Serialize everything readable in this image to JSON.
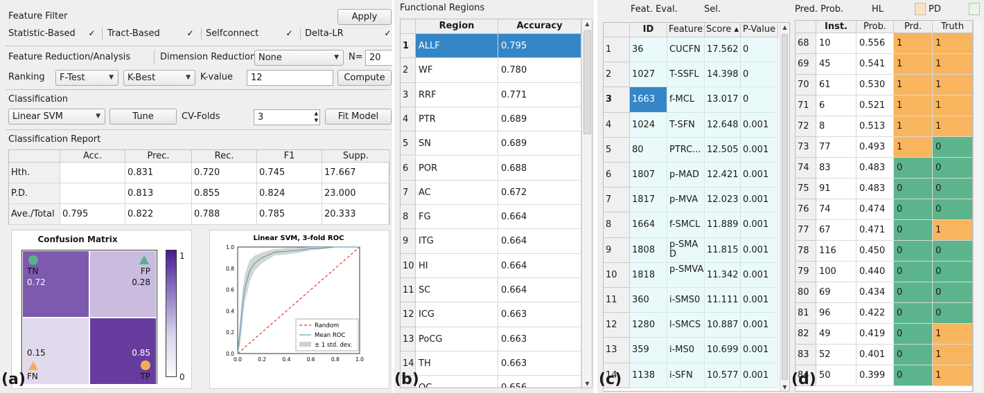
{
  "panel_a": {
    "feature_filter": {
      "title": "Feature Filter",
      "apply_label": "Apply",
      "checks": [
        {
          "label": "Statistic-Based",
          "mark": "✓"
        },
        {
          "label": "Tract-Based",
          "mark": "✓"
        },
        {
          "label": "Selfconnect",
          "mark": "✓"
        },
        {
          "label": "Delta-LR",
          "mark": "✓"
        }
      ]
    },
    "reduction": {
      "title": "Feature Reduction/Analysis",
      "dim_label": "Dimension Reduction",
      "dim_value": "None",
      "n_label": "N=",
      "n_value": "20",
      "ranking_label": "Ranking",
      "ranking_value": "F-Test",
      "kbest_value": "K-Best",
      "kvalue_label": "K-value",
      "kvalue_value": "12",
      "compute_label": "Compute"
    },
    "classification": {
      "title": "Classification",
      "model_value": "Linear SVM",
      "tune_label": "Tune",
      "cv_label": "CV-Folds",
      "cv_value": "3",
      "fit_label": "Fit Model"
    },
    "report": {
      "title": "Classification Report",
      "columns": [
        "",
        "Acc.",
        "Prec.",
        "Rec.",
        "F1",
        "Supp."
      ],
      "rows": [
        [
          "Hth.",
          "",
          "0.831",
          "0.720",
          "0.745",
          "17.667"
        ],
        [
          "P.D.",
          "",
          "0.813",
          "0.855",
          "0.824",
          "23.000"
        ],
        [
          "Ave./Total",
          "0.795",
          "0.822",
          "0.788",
          "0.785",
          "20.333"
        ]
      ]
    },
    "confusion": {
      "title": "Confusion Matrix",
      "cells": [
        {
          "tag": "TN",
          "value": "0.72",
          "level": 0.72,
          "marker": "circle"
        },
        {
          "tag": "FP",
          "value": "0.28",
          "level": 0.28,
          "marker": "triangle"
        },
        {
          "tag": "FN",
          "value": "0.15",
          "level": 0.15,
          "marker": "triangle"
        },
        {
          "tag": "TP",
          "value": "0.85",
          "level": 0.85,
          "marker": "circle"
        }
      ],
      "colorbar_max": "1",
      "colorbar_min": "0",
      "colors": {
        "marker_green": "#55b38a",
        "marker_orange": "#f5ad55",
        "cmap_high": "#4b1b8e",
        "cmap_low": "#fcfbfd"
      }
    },
    "roc": {
      "chart_data": {
        "type": "line",
        "title": "Linear SVM, 3-fold ROC",
        "xlim": [
          0,
          1
        ],
        "ylim": [
          0,
          1
        ],
        "x_ticks": [
          "0.0",
          "0.2",
          "0.4",
          "0.6",
          "0.8",
          "1.0"
        ],
        "y_ticks": [
          "0.0",
          "0.2",
          "0.4",
          "0.6",
          "0.8",
          "1.0"
        ],
        "series": [
          {
            "name": "Random",
            "color": "#e8312c",
            "x": [
              0,
              1
            ],
            "y": [
              0,
              1
            ]
          },
          {
            "name": "Mean ROC",
            "color": "#6aa4b8",
            "x": [
              0,
              0.02,
              0.04,
              0.06,
              0.08,
              0.1,
              0.14,
              0.2,
              0.26,
              0.3,
              0.4,
              0.5,
              0.6,
              0.7,
              0.8,
              0.9,
              1.0
            ],
            "y": [
              0,
              0.2,
              0.45,
              0.62,
              0.7,
              0.78,
              0.85,
              0.9,
              0.93,
              0.95,
              0.96,
              0.97,
              0.985,
              0.99,
              1.0,
              1.0,
              1.0
            ]
          },
          {
            "name": "± 1 std. dev.",
            "color": "#d0d0d0",
            "x": [
              0,
              0.02,
              0.04,
              0.06,
              0.08,
              0.1,
              0.14,
              0.2,
              0.26,
              0.3,
              0.4,
              0.5,
              0.6,
              0.7,
              0.8,
              0.9,
              1.0
            ],
            "upper": [
              0.05,
              0.35,
              0.6,
              0.75,
              0.82,
              0.88,
              0.92,
              0.95,
              0.97,
              0.98,
              0.99,
              0.995,
              1.0,
              1.0,
              1.0,
              1.0,
              1.0
            ],
            "lower": [
              0,
              0.08,
              0.3,
              0.5,
              0.58,
              0.68,
              0.78,
              0.85,
              0.89,
              0.92,
              0.93,
              0.945,
              0.97,
              0.98,
              1.0,
              1.0,
              1.0
            ]
          }
        ],
        "legend_loc": "lower-right"
      }
    },
    "tag": "(a)"
  },
  "panel_b": {
    "title": "Functional Regions",
    "columns": [
      "Region",
      "Accuracy"
    ],
    "rows": [
      [
        "1",
        "ALLF",
        "0.795"
      ],
      [
        "2",
        "WF",
        "0.780"
      ],
      [
        "3",
        "RRF",
        "0.771"
      ],
      [
        "4",
        "PTR",
        "0.689"
      ],
      [
        "5",
        "SN",
        "0.689"
      ],
      [
        "6",
        "POR",
        "0.688"
      ],
      [
        "7",
        "AC",
        "0.672"
      ],
      [
        "8",
        "FG",
        "0.664"
      ],
      [
        "9",
        "ITG",
        "0.664"
      ],
      [
        "10",
        "HI",
        "0.664"
      ],
      [
        "11",
        "SC",
        "0.664"
      ],
      [
        "12",
        "ICG",
        "0.663"
      ],
      [
        "13",
        "PoCG",
        "0.663"
      ],
      [
        "14",
        "TH",
        "0.663"
      ]
    ],
    "partial_row": [
      "",
      "OC",
      "0.656"
    ],
    "selected_row": 0,
    "tag": "(b)"
  },
  "panel_c": {
    "title": "Feat. Eval.",
    "sel_label": "Sel.",
    "columns": [
      "ID",
      "Feature",
      "Score ▴",
      "P-Value"
    ],
    "rows": [
      [
        "1",
        "36",
        "CUCFN",
        "17.562",
        "0"
      ],
      [
        "2",
        "1027",
        "T-SSFL",
        "14.398",
        "0"
      ],
      [
        "3",
        "1663",
        "f-MCL",
        "13.017",
        "0"
      ],
      [
        "4",
        "1024",
        "T-SFN",
        "12.648",
        "0.001"
      ],
      [
        "5",
        "80",
        "PTRC...",
        "12.505",
        "0.001"
      ],
      [
        "6",
        "1807",
        "p-MAD",
        "12.421",
        "0.001"
      ],
      [
        "7",
        "1817",
        "p-MVA",
        "12.023",
        "0.001"
      ],
      [
        "8",
        "1664",
        "f-SMCL",
        "11.889",
        "0.001"
      ],
      [
        "9",
        "1808",
        "p-SMAD",
        "11.815",
        "0.001"
      ],
      [
        "10",
        "1818",
        "p-SMVA",
        "11.342",
        "0.001"
      ],
      [
        "11",
        "360",
        "i-SMS0",
        "11.111",
        "0.001"
      ],
      [
        "12",
        "1280",
        "l-SMCS",
        "10.887",
        "0.001"
      ],
      [
        "13",
        "359",
        "i-MS0",
        "10.699",
        "0.001"
      ],
      [
        "14",
        "1138",
        "i-SFN",
        "10.577",
        "0.001"
      ]
    ],
    "selected_row": 2,
    "tag": "(c)"
  },
  "panel_d": {
    "title": "Pred. Prob.",
    "hl_label": "HL",
    "pd_label": "PD",
    "columns": [
      "Inst.",
      "Prob.",
      "Prd.",
      "Truth"
    ],
    "rows": [
      [
        "68",
        "10",
        "0.556",
        "1",
        "1"
      ],
      [
        "69",
        "45",
        "0.541",
        "1",
        "1"
      ],
      [
        "70",
        "61",
        "0.530",
        "1",
        "1"
      ],
      [
        "71",
        "6",
        "0.521",
        "1",
        "1"
      ],
      [
        "72",
        "8",
        "0.513",
        "1",
        "1"
      ],
      [
        "73",
        "77",
        "0.493",
        "1",
        "0"
      ],
      [
        "74",
        "83",
        "0.483",
        "0",
        "0"
      ],
      [
        "75",
        "91",
        "0.483",
        "0",
        "0"
      ],
      [
        "76",
        "74",
        "0.474",
        "0",
        "0"
      ],
      [
        "77",
        "67",
        "0.471",
        "0",
        "1"
      ],
      [
        "78",
        "116",
        "0.450",
        "0",
        "0"
      ],
      [
        "79",
        "100",
        "0.440",
        "0",
        "0"
      ],
      [
        "80",
        "69",
        "0.434",
        "0",
        "0"
      ],
      [
        "81",
        "96",
        "0.422",
        "0",
        "0"
      ],
      [
        "82",
        "49",
        "0.419",
        "0",
        "1"
      ],
      [
        "83",
        "52",
        "0.401",
        "0",
        "1"
      ],
      [
        "84",
        "50",
        "0.399",
        "0",
        "1"
      ]
    ],
    "colors": {
      "one": "#f8b55e",
      "zero": "#5cb48c",
      "hl_swatch": "#ffe2c6",
      "pd_swatch": "#e8f6e8"
    },
    "tag": "(d)"
  }
}
